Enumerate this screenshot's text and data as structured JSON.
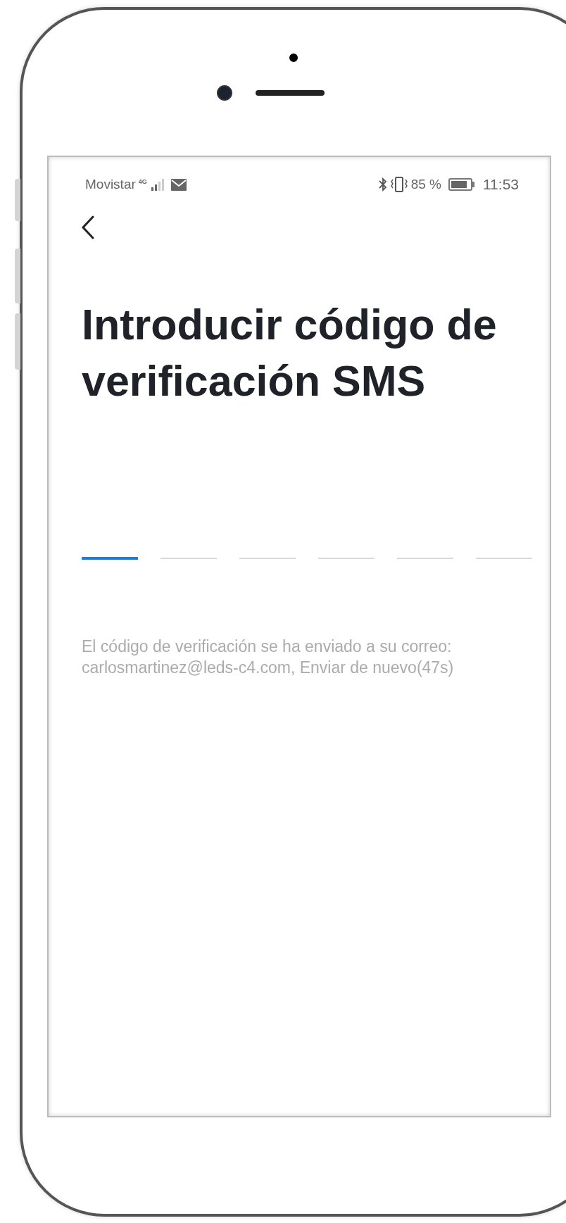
{
  "status_bar": {
    "carrier": "Movistar",
    "network": "4G",
    "battery": "85 %",
    "time": "11:53"
  },
  "title": "Introducir código de\nverificación SMS",
  "code_slots": [
    {
      "selected": true
    },
    {
      "selected": false
    },
    {
      "selected": false
    },
    {
      "selected": false
    },
    {
      "selected": false
    },
    {
      "selected": false
    }
  ],
  "message": "El código de verificación se ha enviado a su correo:\ncarlosmartinez@leds-c4.com, Enviar de nuevo(47s)"
}
